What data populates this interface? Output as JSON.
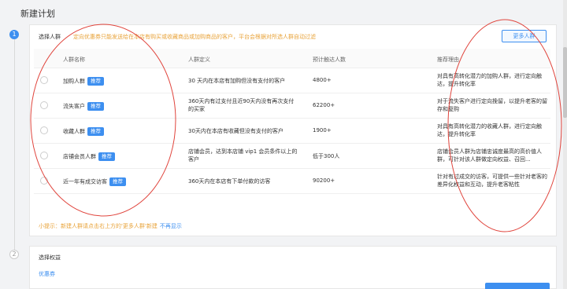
{
  "page": {
    "title": "新建计划"
  },
  "steps": {
    "one": "1",
    "two": "2"
  },
  "audience": {
    "label": "选择人群",
    "hint": "定向优惠券只能发送给在本店有购买或收藏商品或加购商品的客户，平台会根据对所选人群自动过滤",
    "more_button": "更多人群",
    "headers": {
      "name": "人群名称",
      "definition": "人群定义",
      "reach": "预计触达人数",
      "reason": "推荐理由"
    },
    "rows": [
      {
        "name": "加购人群",
        "tag": "推荐",
        "definition": "30 天内在本店有加购但没有支付的客户",
        "reach": "4800+",
        "reason": "对具有高转化潜力的加购人群，进行定向触达，提升转化率"
      },
      {
        "name": "流失客户",
        "tag": "推荐",
        "definition": "360天内有过支付且近90天内没有再次支付的买家",
        "reach": "62200+",
        "reason": "对于流失客户进行定向挽留，以提升老客的留存和复购"
      },
      {
        "name": "收藏人群",
        "tag": "推荐",
        "definition": "30天内在本店有收藏但没有支付的客户",
        "reach": "1900+",
        "reason": "对具有高转化潜力的收藏人群，进行定向触达，提升转化率"
      },
      {
        "name": "店铺会员人群",
        "tag": "推荐",
        "definition": "店铺会员，达到本店铺 vip1 会员条件以上的客户",
        "reach": "低于300人",
        "reason": "店铺会员人群为店铺忠诚度最高的高价值人群，可针对该人群做定向权益、召回..."
      },
      {
        "name": "近一年有成交访客",
        "tag": "推荐",
        "definition": "360天内在本店有下单付款的访客",
        "reach": "90200+",
        "reason": "针对有过成交的访客，可提供一些针对老客的差异化权益和互动，提升老客粘性"
      }
    ],
    "tip_text": "小提示：新建人群请点击右上方的'更多人群'新建",
    "tip_link": "不再显示"
  },
  "benefits": {
    "label": "选择权益",
    "link": "优惠券"
  }
}
